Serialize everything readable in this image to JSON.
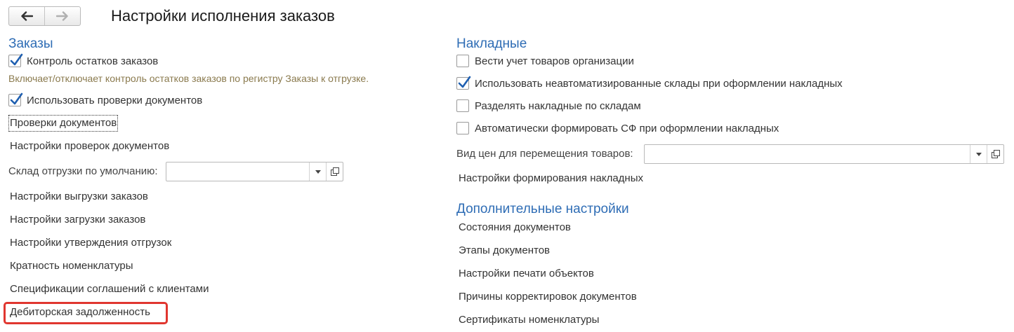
{
  "title": "Настройки исполнения заказов",
  "left": {
    "section_title": "Заказы",
    "checkbox_stock_control": {
      "label": "Контроль остатков заказов",
      "checked": true
    },
    "hint": "Включает/отключает контроль остатков заказов по регистру Заказы к отгрузке.",
    "checkbox_doc_checks": {
      "label": "Использовать проверки документов",
      "checked": true
    },
    "link_doc_checks": "Проверки документов",
    "link_doc_checks_settings": "Настройки проверок документов",
    "default_warehouse_label": "Склад отгрузки по умолчанию:",
    "default_warehouse_value": "",
    "links": [
      "Настройки выгрузки заказов",
      "Настройки загрузки заказов",
      "Настройки утверждения отгрузок",
      "Кратность номенклатуры",
      "Спецификации соглашений с клиентами",
      "Дебиторская задолженность"
    ]
  },
  "right": {
    "section_title": "Накладные",
    "checkboxes": [
      {
        "label": "Вести учет товаров организации",
        "checked": false
      },
      {
        "label": "Использовать неавтоматизированные склады при оформлении накладных",
        "checked": true
      },
      {
        "label": "Разделять накладные по складам",
        "checked": false
      },
      {
        "label": "Автоматически формировать СФ при оформлении накладных",
        "checked": false
      }
    ],
    "price_type_label": "Вид цен для перемещения товаров:",
    "price_type_value": "",
    "link_invoice_settings": "Настройки формирования накладных",
    "additional_title": "Дополнительные настройки",
    "additional_links": [
      "Состояния документов",
      "Этапы документов",
      "Настройки печати объектов",
      "Причины корректировок документов",
      "Сертификаты номенклатуры"
    ]
  },
  "colors": {
    "section": "#2f6db5",
    "check": "#1f5fb0",
    "hint": "#8a7a4e",
    "highlight": "#e0362f"
  },
  "icons": {
    "back": "arrow-left-icon",
    "forward": "arrow-right-icon",
    "dropdown": "triangle-down-icon",
    "open": "open-window-icon"
  }
}
